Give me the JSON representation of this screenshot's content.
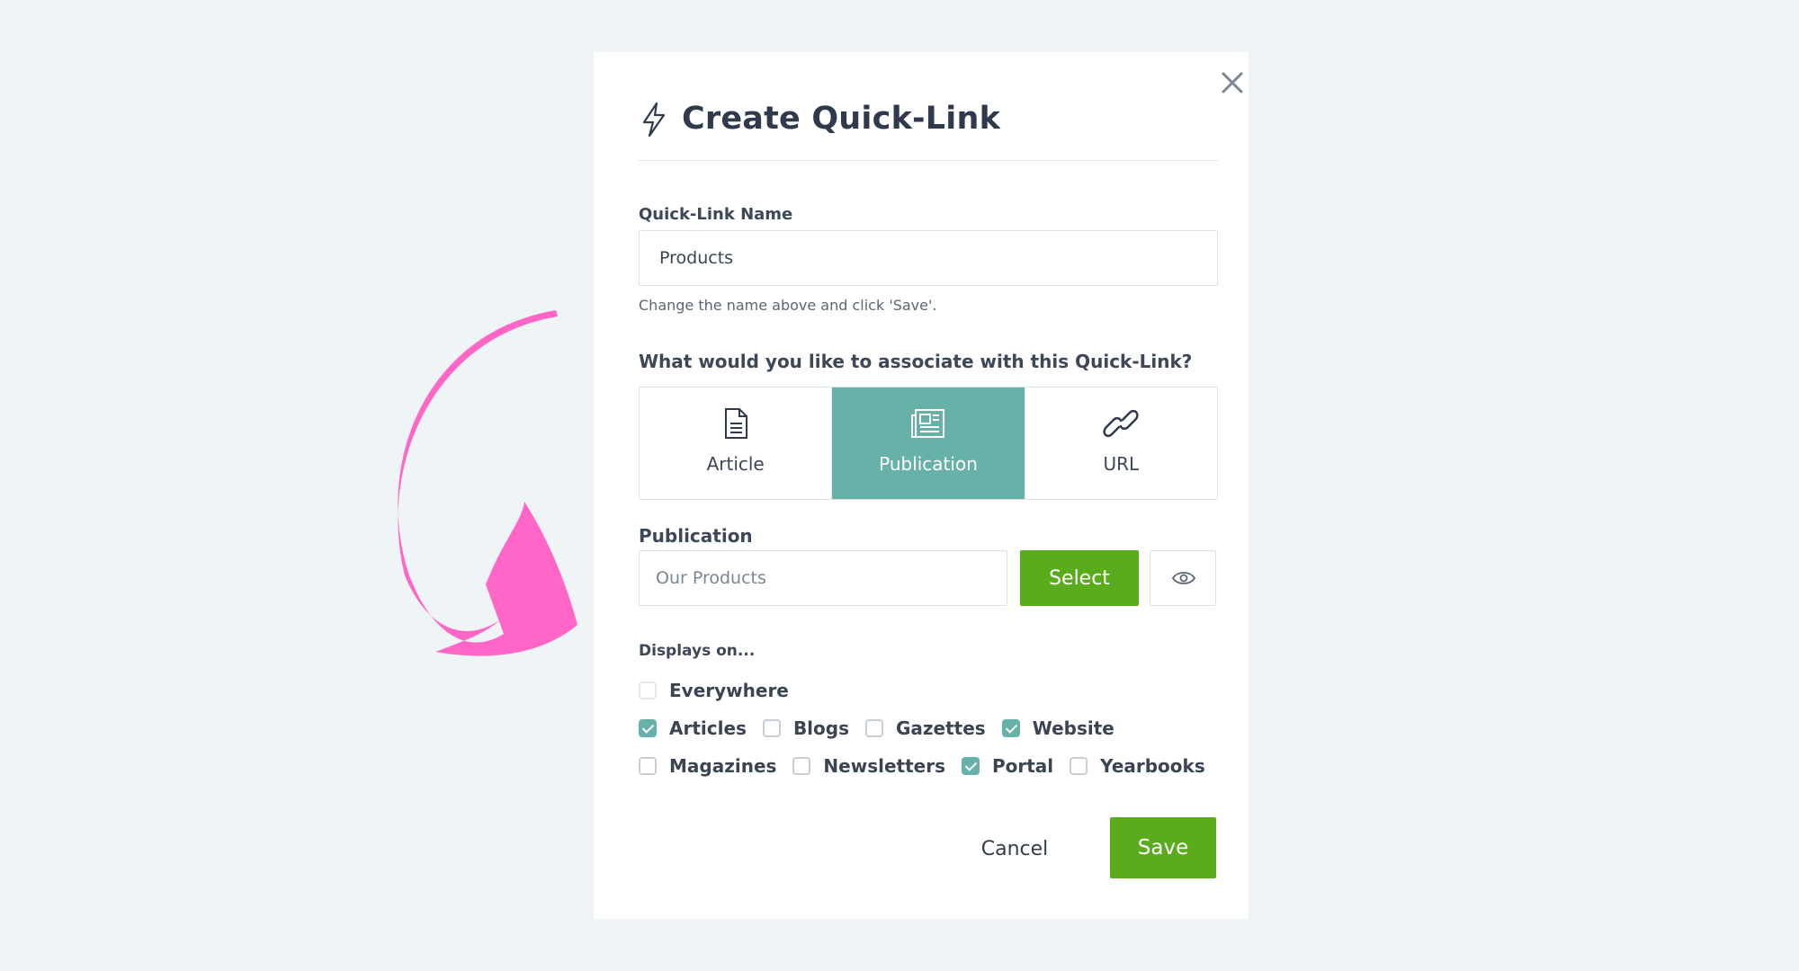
{
  "modal": {
    "title": "Create Quick-Link",
    "icon": "lightning-icon"
  },
  "name_field": {
    "label": "Quick-Link Name",
    "value": "Products",
    "helper": "Change the name above and click 'Save'."
  },
  "association": {
    "question": "What would you like to associate with this Quick-Link?",
    "options": [
      {
        "label": "Article",
        "icon": "document-icon",
        "selected": false
      },
      {
        "label": "Publication",
        "icon": "newspaper-icon",
        "selected": true
      },
      {
        "label": "URL",
        "icon": "link-icon",
        "selected": false
      }
    ]
  },
  "publication": {
    "label": "Publication",
    "placeholder": "Our Products",
    "select_label": "Select"
  },
  "displays": {
    "label": "Displays on...",
    "everywhere": {
      "label": "Everywhere",
      "checked": false
    },
    "row1": [
      {
        "label": "Articles",
        "checked": true
      },
      {
        "label": "Blogs",
        "checked": false
      },
      {
        "label": "Gazettes",
        "checked": false
      },
      {
        "label": "Website",
        "checked": true
      }
    ],
    "row2": [
      {
        "label": "Magazines",
        "checked": false
      },
      {
        "label": "Newsletters",
        "checked": false
      },
      {
        "label": "Portal",
        "checked": true
      },
      {
        "label": "Yearbooks",
        "checked": false
      }
    ]
  },
  "footer": {
    "cancel_label": "Cancel",
    "save_label": "Save"
  },
  "colors": {
    "accent_teal": "#66b1a8",
    "button_green": "#5aac1c",
    "highlight_pink": "#ff63c8"
  }
}
